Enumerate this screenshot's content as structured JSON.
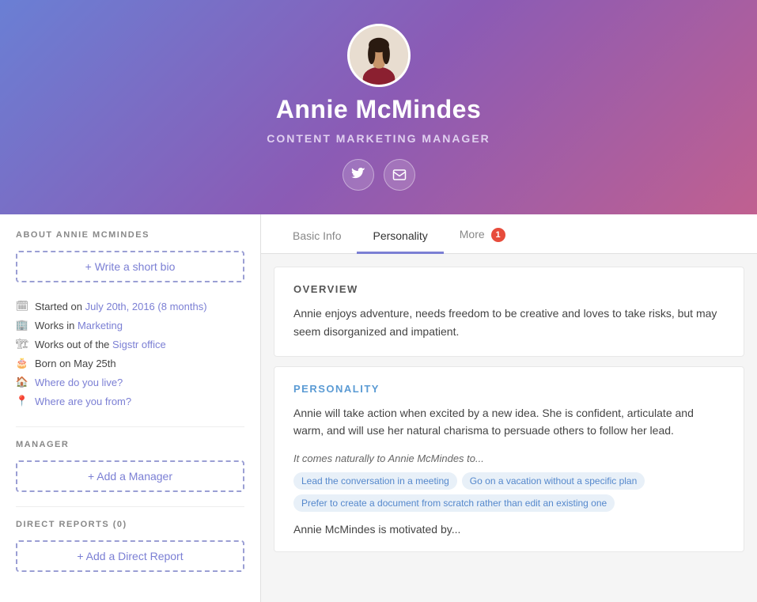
{
  "header": {
    "name": "Annie McMindes",
    "title": "CONTENT MARKETING MANAGER",
    "twitter_label": "Twitter",
    "email_label": "Email"
  },
  "sidebar": {
    "about_title": "ABOUT ANNIE MCMINDES",
    "write_bio_label": "+ Write a short bio",
    "info_items": [
      {
        "icon": "calendar-icon",
        "text_plain": "Started on ",
        "text_link": "July 20th, 2016 (8 months)",
        "link": true
      },
      {
        "icon": "building-icon",
        "text_plain": "Works in ",
        "text_link": "Marketing",
        "link": true
      },
      {
        "icon": "office-icon",
        "text_plain": "Works out of the ",
        "text_link": "Sigstr office",
        "link": true
      },
      {
        "icon": "birthday-icon",
        "text_plain": "Born on May 25th",
        "text_link": "",
        "link": false
      },
      {
        "icon": "home-icon",
        "text_plain": "",
        "text_link": "Where do you live?",
        "link": true
      },
      {
        "icon": "location-icon",
        "text_plain": "",
        "text_link": "Where are you from?",
        "link": true
      }
    ],
    "manager_title": "MANAGER",
    "add_manager_label": "+ Add a Manager",
    "direct_reports_title": "DIRECT REPORTS (0)",
    "add_report_label": "+ Add a Direct Report"
  },
  "tabs": [
    {
      "id": "basic-info",
      "label": "Basic Info",
      "active": false
    },
    {
      "id": "personality",
      "label": "Personality",
      "active": true
    },
    {
      "id": "more",
      "label": "More",
      "badge": "1",
      "active": false
    }
  ],
  "personality_card": {
    "overview_title": "OVERVIEW",
    "overview_text": "Annie enjoys adventure, needs freedom to be creative and loves to take risks, but may seem disorganized and impatient.",
    "personality_title": "PERSONALITY",
    "personality_text": "Annie will take action when excited by a new idea. She is confident, articulate and warm, and will use her natural charisma to persuade others to follow her lead.",
    "naturally_subtitle": "It comes naturally to Annie McMindes to...",
    "tags": [
      "Lead the conversation in a meeting",
      "Go on a vacation without a specific plan",
      "Prefer to create a document from scratch rather than edit an existing one"
    ],
    "motivated_title": "Annie McMindes is motivated by..."
  }
}
